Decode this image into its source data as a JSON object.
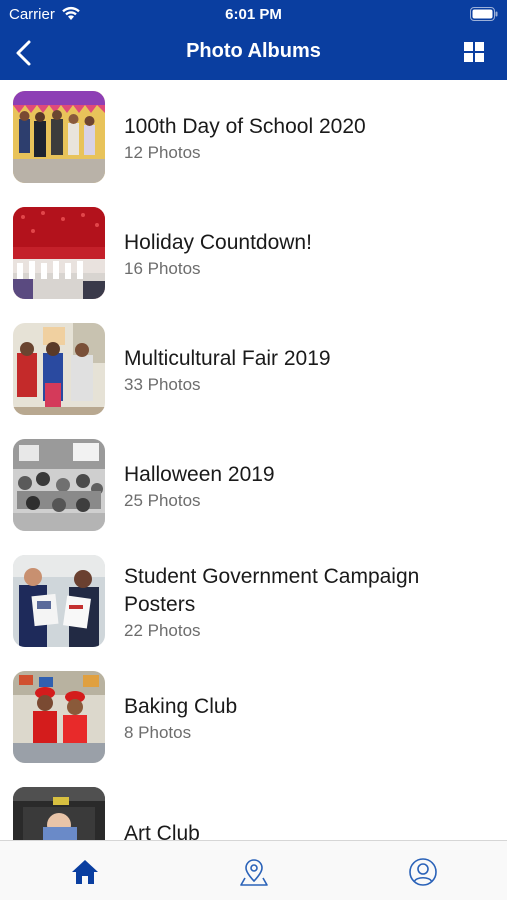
{
  "status_bar": {
    "carrier": "Carrier",
    "time": "6:01 PM"
  },
  "nav": {
    "title": "Photo Albums"
  },
  "albums": [
    {
      "title": "100th Day of School 2020",
      "count": "12 Photos"
    },
    {
      "title": "Holiday Countdown!",
      "count": "16 Photos"
    },
    {
      "title": "Multicultural Fair 2019",
      "count": "33 Photos"
    },
    {
      "title": "Halloween 2019",
      "count": "25 Photos"
    },
    {
      "title": "Student Government Campaign Posters",
      "count": "22 Photos"
    },
    {
      "title": "Baking Club",
      "count": "8 Photos"
    },
    {
      "title": "Art Club",
      "count": ""
    }
  ],
  "tabs": [
    "home-icon",
    "map-pin-icon",
    "profile-icon"
  ],
  "colors": {
    "header": "#0a3ea0",
    "tab_active": "#0a3ea0",
    "tab_inactive": "#2a62b8"
  }
}
